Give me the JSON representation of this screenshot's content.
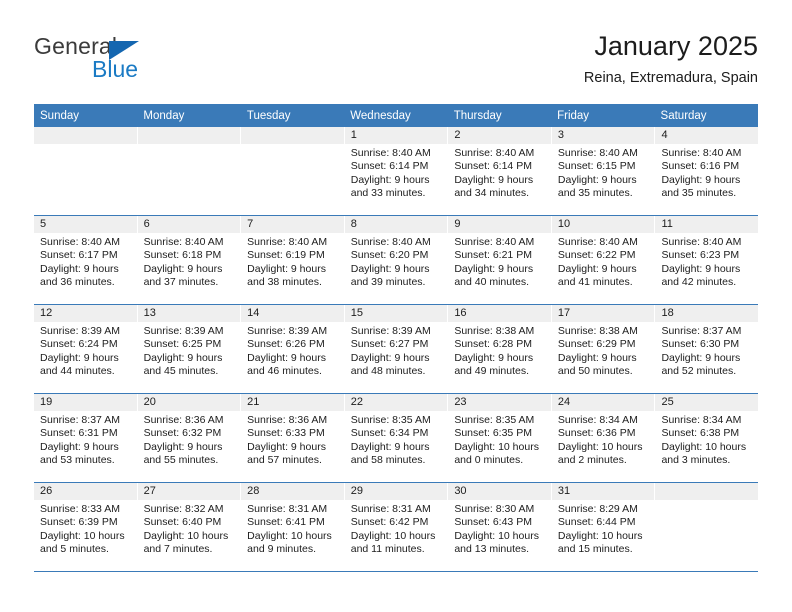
{
  "brand": {
    "name_top": "General",
    "name_bottom": "Blue",
    "flag_icon": "blue-triangle-flag",
    "color_top": "#3b3b3b",
    "color_bottom": "#1a7ac4"
  },
  "header": {
    "title": "January 2025",
    "subtitle": "Reina, Extremadura, Spain"
  },
  "theme": {
    "header_blue": "#3a7ab8",
    "day_band_gray": "#efefef",
    "text": "#1d1d1d"
  },
  "calendar": {
    "weekdays": [
      "Sunday",
      "Monday",
      "Tuesday",
      "Wednesday",
      "Thursday",
      "Friday",
      "Saturday"
    ],
    "labels": {
      "sunrise": "Sunrise:",
      "sunset": "Sunset:",
      "daylight": "Daylight:"
    },
    "weeks": [
      [
        {
          "day": "",
          "empty": true
        },
        {
          "day": "",
          "empty": true
        },
        {
          "day": "",
          "empty": true
        },
        {
          "day": "1",
          "sunrise": "Sunrise: 8:40 AM",
          "sunset": "Sunset: 6:14 PM",
          "daylight1": "Daylight: 9 hours",
          "daylight2": "and 33 minutes."
        },
        {
          "day": "2",
          "sunrise": "Sunrise: 8:40 AM",
          "sunset": "Sunset: 6:14 PM",
          "daylight1": "Daylight: 9 hours",
          "daylight2": "and 34 minutes."
        },
        {
          "day": "3",
          "sunrise": "Sunrise: 8:40 AM",
          "sunset": "Sunset: 6:15 PM",
          "daylight1": "Daylight: 9 hours",
          "daylight2": "and 35 minutes."
        },
        {
          "day": "4",
          "sunrise": "Sunrise: 8:40 AM",
          "sunset": "Sunset: 6:16 PM",
          "daylight1": "Daylight: 9 hours",
          "daylight2": "and 35 minutes."
        }
      ],
      [
        {
          "day": "5",
          "sunrise": "Sunrise: 8:40 AM",
          "sunset": "Sunset: 6:17 PM",
          "daylight1": "Daylight: 9 hours",
          "daylight2": "and 36 minutes."
        },
        {
          "day": "6",
          "sunrise": "Sunrise: 8:40 AM",
          "sunset": "Sunset: 6:18 PM",
          "daylight1": "Daylight: 9 hours",
          "daylight2": "and 37 minutes."
        },
        {
          "day": "7",
          "sunrise": "Sunrise: 8:40 AM",
          "sunset": "Sunset: 6:19 PM",
          "daylight1": "Daylight: 9 hours",
          "daylight2": "and 38 minutes."
        },
        {
          "day": "8",
          "sunrise": "Sunrise: 8:40 AM",
          "sunset": "Sunset: 6:20 PM",
          "daylight1": "Daylight: 9 hours",
          "daylight2": "and 39 minutes."
        },
        {
          "day": "9",
          "sunrise": "Sunrise: 8:40 AM",
          "sunset": "Sunset: 6:21 PM",
          "daylight1": "Daylight: 9 hours",
          "daylight2": "and 40 minutes."
        },
        {
          "day": "10",
          "sunrise": "Sunrise: 8:40 AM",
          "sunset": "Sunset: 6:22 PM",
          "daylight1": "Daylight: 9 hours",
          "daylight2": "and 41 minutes."
        },
        {
          "day": "11",
          "sunrise": "Sunrise: 8:40 AM",
          "sunset": "Sunset: 6:23 PM",
          "daylight1": "Daylight: 9 hours",
          "daylight2": "and 42 minutes."
        }
      ],
      [
        {
          "day": "12",
          "sunrise": "Sunrise: 8:39 AM",
          "sunset": "Sunset: 6:24 PM",
          "daylight1": "Daylight: 9 hours",
          "daylight2": "and 44 minutes."
        },
        {
          "day": "13",
          "sunrise": "Sunrise: 8:39 AM",
          "sunset": "Sunset: 6:25 PM",
          "daylight1": "Daylight: 9 hours",
          "daylight2": "and 45 minutes."
        },
        {
          "day": "14",
          "sunrise": "Sunrise: 8:39 AM",
          "sunset": "Sunset: 6:26 PM",
          "daylight1": "Daylight: 9 hours",
          "daylight2": "and 46 minutes."
        },
        {
          "day": "15",
          "sunrise": "Sunrise: 8:39 AM",
          "sunset": "Sunset: 6:27 PM",
          "daylight1": "Daylight: 9 hours",
          "daylight2": "and 48 minutes."
        },
        {
          "day": "16",
          "sunrise": "Sunrise: 8:38 AM",
          "sunset": "Sunset: 6:28 PM",
          "daylight1": "Daylight: 9 hours",
          "daylight2": "and 49 minutes."
        },
        {
          "day": "17",
          "sunrise": "Sunrise: 8:38 AM",
          "sunset": "Sunset: 6:29 PM",
          "daylight1": "Daylight: 9 hours",
          "daylight2": "and 50 minutes."
        },
        {
          "day": "18",
          "sunrise": "Sunrise: 8:37 AM",
          "sunset": "Sunset: 6:30 PM",
          "daylight1": "Daylight: 9 hours",
          "daylight2": "and 52 minutes."
        }
      ],
      [
        {
          "day": "19",
          "sunrise": "Sunrise: 8:37 AM",
          "sunset": "Sunset: 6:31 PM",
          "daylight1": "Daylight: 9 hours",
          "daylight2": "and 53 minutes."
        },
        {
          "day": "20",
          "sunrise": "Sunrise: 8:36 AM",
          "sunset": "Sunset: 6:32 PM",
          "daylight1": "Daylight: 9 hours",
          "daylight2": "and 55 minutes."
        },
        {
          "day": "21",
          "sunrise": "Sunrise: 8:36 AM",
          "sunset": "Sunset: 6:33 PM",
          "daylight1": "Daylight: 9 hours",
          "daylight2": "and 57 minutes."
        },
        {
          "day": "22",
          "sunrise": "Sunrise: 8:35 AM",
          "sunset": "Sunset: 6:34 PM",
          "daylight1": "Daylight: 9 hours",
          "daylight2": "and 58 minutes."
        },
        {
          "day": "23",
          "sunrise": "Sunrise: 8:35 AM",
          "sunset": "Sunset: 6:35 PM",
          "daylight1": "Daylight: 10 hours",
          "daylight2": "and 0 minutes."
        },
        {
          "day": "24",
          "sunrise": "Sunrise: 8:34 AM",
          "sunset": "Sunset: 6:36 PM",
          "daylight1": "Daylight: 10 hours",
          "daylight2": "and 2 minutes."
        },
        {
          "day": "25",
          "sunrise": "Sunrise: 8:34 AM",
          "sunset": "Sunset: 6:38 PM",
          "daylight1": "Daylight: 10 hours",
          "daylight2": "and 3 minutes."
        }
      ],
      [
        {
          "day": "26",
          "sunrise": "Sunrise: 8:33 AM",
          "sunset": "Sunset: 6:39 PM",
          "daylight1": "Daylight: 10 hours",
          "daylight2": "and 5 minutes."
        },
        {
          "day": "27",
          "sunrise": "Sunrise: 8:32 AM",
          "sunset": "Sunset: 6:40 PM",
          "daylight1": "Daylight: 10 hours",
          "daylight2": "and 7 minutes."
        },
        {
          "day": "28",
          "sunrise": "Sunrise: 8:31 AM",
          "sunset": "Sunset: 6:41 PM",
          "daylight1": "Daylight: 10 hours",
          "daylight2": "and 9 minutes."
        },
        {
          "day": "29",
          "sunrise": "Sunrise: 8:31 AM",
          "sunset": "Sunset: 6:42 PM",
          "daylight1": "Daylight: 10 hours",
          "daylight2": "and 11 minutes."
        },
        {
          "day": "30",
          "sunrise": "Sunrise: 8:30 AM",
          "sunset": "Sunset: 6:43 PM",
          "daylight1": "Daylight: 10 hours",
          "daylight2": "and 13 minutes."
        },
        {
          "day": "31",
          "sunrise": "Sunrise: 8:29 AM",
          "sunset": "Sunset: 6:44 PM",
          "daylight1": "Daylight: 10 hours",
          "daylight2": "and 15 minutes."
        },
        {
          "day": "",
          "empty": true
        }
      ]
    ]
  }
}
